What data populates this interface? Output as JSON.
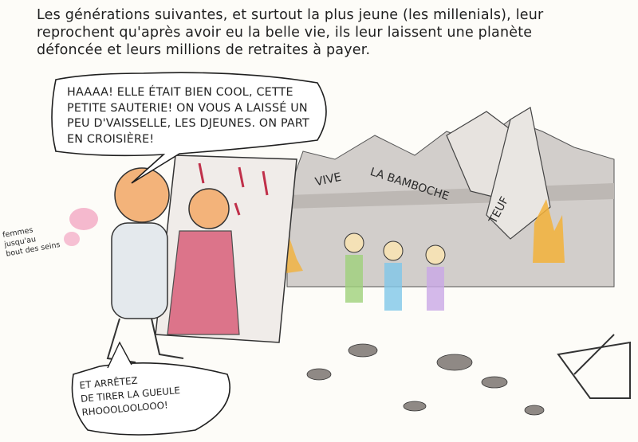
{
  "caption": {
    "line1": "Les générations suivantes, et surtout la plus jeune (les millenials), leur",
    "line2": "reprochent qu'après avoir eu la belle vie, ils leur laissent une planète",
    "line3": "défoncée et leurs millions de retraites à payer."
  },
  "speech_bubble_top": {
    "line1": "Haaaa! Elle était bien cool, cette",
    "line2": "petite sauterie! On vous a laissé un",
    "line3": "peu d'vaisselle, les djeunes. On part",
    "line4": "en croisière!"
  },
  "speech_bubble_bottom": {
    "line1": "Et arrêtez",
    "line2": "de tirer la gueule",
    "line3": "rhoooloolooo!"
  },
  "banners": {
    "left": "VIVE",
    "middle": "LA BAMBOCHE",
    "right": "TEUF"
  },
  "side_note": {
    "line1": "femmes",
    "line2": "jusqu'au",
    "line3": "bout des seins"
  },
  "colors": {
    "ink": "#1f1f1f",
    "skin": "#f3b37a",
    "woman_coat": "#d9607a",
    "wall_grey": "#c8c4c0",
    "fire": "#f3b23a",
    "pink_blob": "#f2a7c3"
  }
}
